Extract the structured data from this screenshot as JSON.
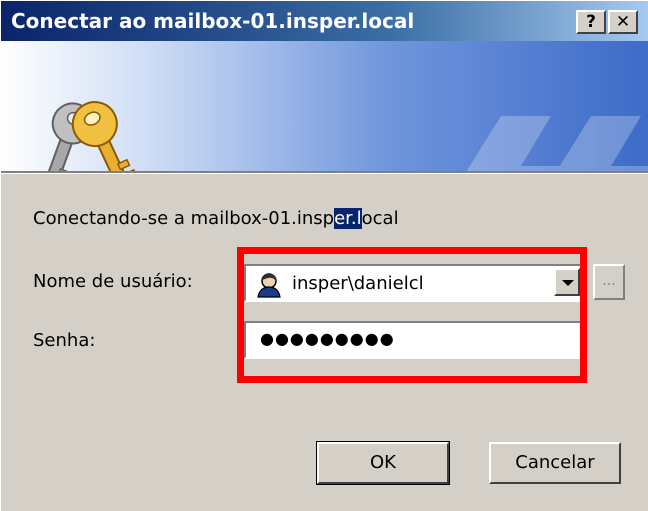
{
  "window": {
    "title": "Conectar ao mailbox-01.insper.local",
    "help_button": "?",
    "close_button": "✕"
  },
  "dialog": {
    "connecting_text_pre": "Conectando-se a mailbox-01.insp",
    "connecting_text_selected": "er.l",
    "connecting_text_post": "ocal",
    "username_label": "Nome de usuário:",
    "username_value": "insper\\danielcl",
    "browse_label": "...",
    "password_label": "Senha:",
    "password_value": "●●●●●●●●●"
  },
  "buttons": {
    "ok": "OK",
    "cancel": "Cancelar"
  },
  "colors": {
    "highlight": "#ff0000",
    "titlebar": "#0a246a",
    "selection": "#0a246a"
  }
}
